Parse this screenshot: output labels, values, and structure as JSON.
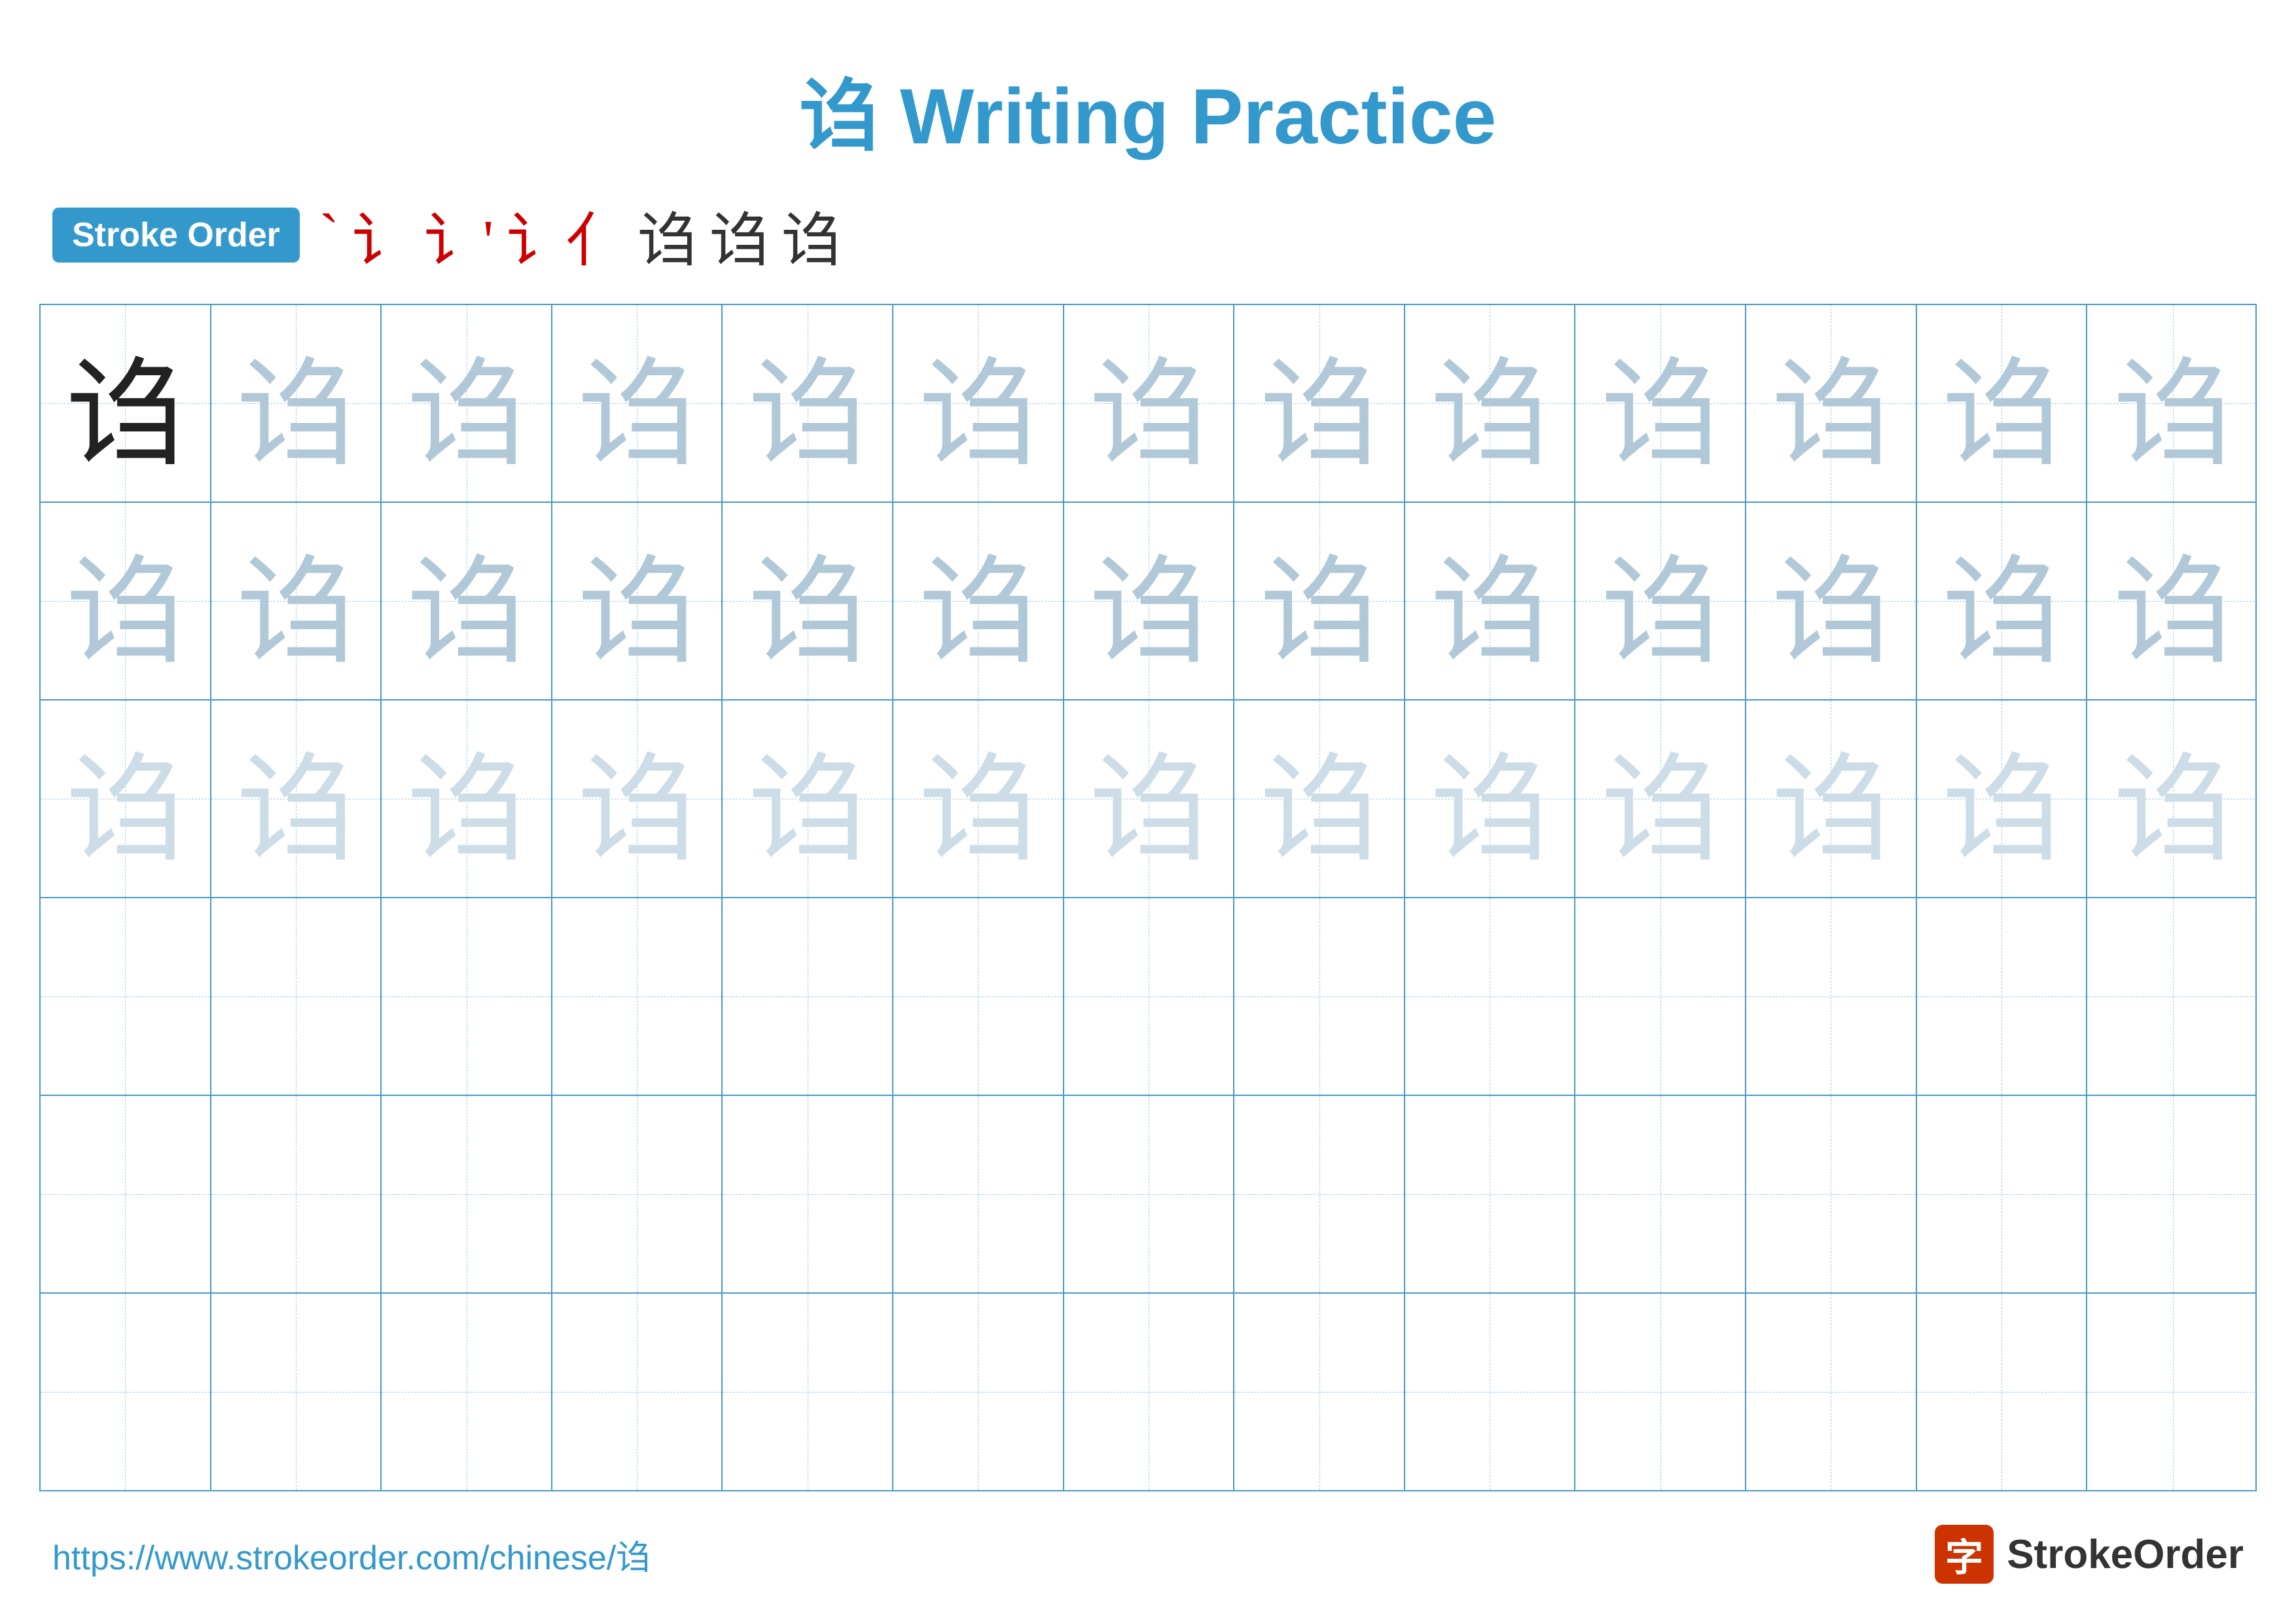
{
  "title": {
    "character": "诌",
    "label": "Writing Practice",
    "full": "诌 Writing Practice"
  },
  "stroke_order": {
    "badge_label": "Stroke Order",
    "strokes": [
      "﹀",
      "讠",
      "讠'",
      "讠亻",
      "诌",
      "诌",
      "诌"
    ]
  },
  "grid": {
    "rows": 6,
    "cols": 13,
    "character": "诌",
    "row_styles": [
      "dark",
      "medium",
      "light",
      "empty",
      "empty",
      "empty"
    ]
  },
  "footer": {
    "url": "https://www.strokeorder.com/chinese/诌",
    "logo_icon": "字",
    "logo_text": "StrokeOrder"
  }
}
